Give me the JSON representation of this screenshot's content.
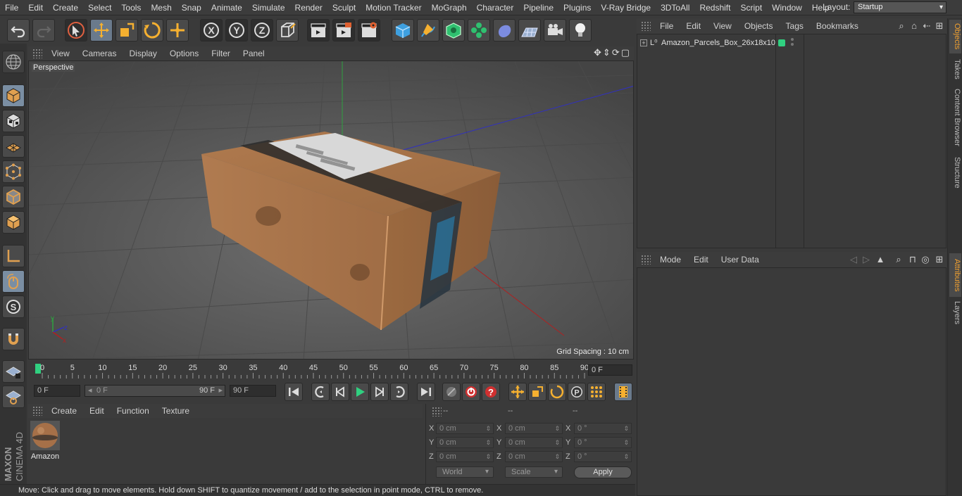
{
  "menu": [
    "File",
    "Edit",
    "Create",
    "Select",
    "Tools",
    "Mesh",
    "Snap",
    "Animate",
    "Simulate",
    "Render",
    "Sculpt",
    "Motion Tracker",
    "MoGraph",
    "Character",
    "Pipeline",
    "Plugins",
    "V-Ray Bridge",
    "3DToAll",
    "Redshift",
    "Script",
    "Window",
    "Help"
  ],
  "layout": {
    "label": "Layout:",
    "value": "Startup"
  },
  "viewport": {
    "menu": [
      "View",
      "Cameras",
      "Display",
      "Options",
      "Filter",
      "Panel"
    ],
    "label": "Perspective",
    "grid_spacing": "Grid Spacing : 10 cm"
  },
  "timeline": {
    "ticks": [
      "0",
      "5",
      "10",
      "15",
      "20",
      "25",
      "30",
      "35",
      "40",
      "45",
      "50",
      "55",
      "60",
      "65",
      "70",
      "75",
      "80",
      "85",
      "90"
    ],
    "current_frame": "0 F"
  },
  "transport": {
    "start": "0 F",
    "range_start": "0 F",
    "range_end": "90 F",
    "end": "90 F"
  },
  "material_manager": {
    "menu": [
      "Create",
      "Edit",
      "Function",
      "Texture"
    ],
    "material_name": "Amazon"
  },
  "coordinates": {
    "headers": [
      "--",
      "--",
      "--"
    ],
    "rows": [
      {
        "axis": "X",
        "pos": "0 cm",
        "size_axis": "X",
        "size": "0 cm",
        "rot_axis": "X",
        "rot": "0 °"
      },
      {
        "axis": "Y",
        "pos": "0 cm",
        "size_axis": "Y",
        "size": "0 cm",
        "rot_axis": "Y",
        "rot": "0 °"
      },
      {
        "axis": "Z",
        "pos": "0 cm",
        "size_axis": "Z",
        "size": "0 cm",
        "rot_axis": "Z",
        "rot": "0 °"
      }
    ],
    "mode": "World",
    "scale": "Scale",
    "apply": "Apply"
  },
  "status": "Move: Click and drag to move elements. Hold down SHIFT to quantize movement / add to the selection in point mode, CTRL to remove.",
  "object_manager": {
    "menu": [
      "File",
      "Edit",
      "View",
      "Objects",
      "Tags",
      "Bookmarks"
    ],
    "object_name": "Amazon_Parcels_Box_26x18x10"
  },
  "attributes": {
    "menu": [
      "Mode",
      "Edit",
      "User Data"
    ]
  },
  "right_tabs": [
    "Objects",
    "Takes",
    "Content Browser",
    "Structure",
    "Attributes",
    "Layers"
  ],
  "brand": {
    "maxon": "MAXON",
    "product": "CINEMA 4D"
  }
}
